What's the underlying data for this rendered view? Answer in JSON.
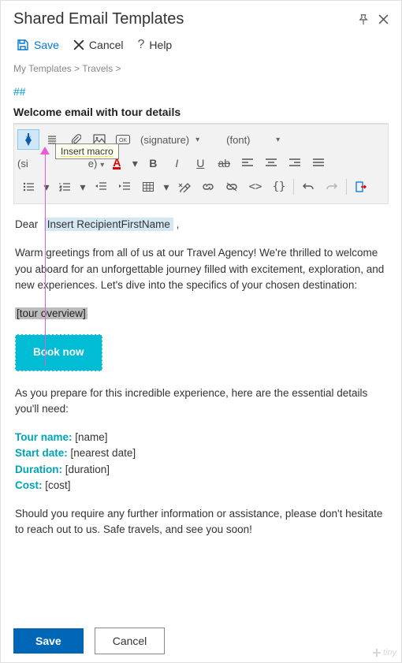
{
  "window": {
    "title": "Shared Email Templates"
  },
  "actions": {
    "save": "Save",
    "cancel": "Cancel",
    "help": "Help"
  },
  "breadcrumb": {
    "root": "My Templates",
    "sep": ">",
    "node": "Travels"
  },
  "hash": "##",
  "template_title": "Welcome email with tour details",
  "toolbar": {
    "tooltip": "Insert macro",
    "signature": "(signature)",
    "font": "(font)",
    "size_fragment": "(si",
    "size_fragment_end": "e)"
  },
  "body": {
    "greeting_prefix": "Dear",
    "recipient_chip": "Insert RecipientFirstName",
    "greeting_suffix": ",",
    "intro": "Warm greetings from all of us at our Travel Agency! We're thrilled to welcome you aboard for an unforgettable journey filled with excitement, exploration, and new experiences. Let's dive into the specifics of your chosen destination:",
    "tour_overview": "[tour overview]",
    "book_now": "Book now",
    "prepare": "As you prepare for this incredible experience, here are the essential details you'll need:",
    "tour_name_label": "Tour name:",
    "tour_name_val": "[name]",
    "start_date_label": "Start date:",
    "start_date_val": "[nearest date]",
    "duration_label": "Duration:",
    "duration_val": "[duration]",
    "cost_label": "Cost:",
    "cost_val": "[cost]",
    "closing": "Should you require any further information or assistance, please don't hesitate to reach out to us. Safe travels, and see you soon!"
  },
  "footer": {
    "save": "Save",
    "cancel": "Cancel",
    "logo": "tiny"
  }
}
